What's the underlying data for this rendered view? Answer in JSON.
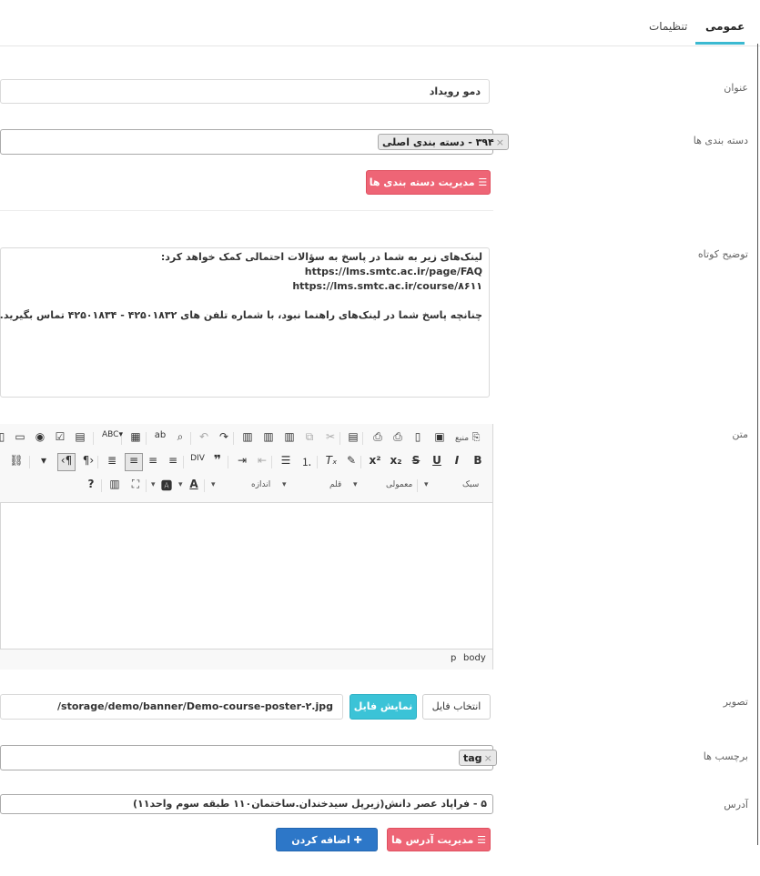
{
  "tabs": [
    {
      "label": "عمومی",
      "active": true
    },
    {
      "label": "تنظیمات",
      "active": false
    }
  ],
  "fields": {
    "title_label": "عنوان",
    "title_value": "دمو رویداد",
    "categories_label": "دسته بندی ها",
    "category_tag": "۳۹۴ - دسته بندی اصلی",
    "manage_categories_button": "مدیریت دسته بندی ها",
    "short_desc_label": "توضیح کوتاه",
    "short_desc_lines": [
      "لینک‌های زیر به شما در پاسخ به سؤالات احتمالی کمک خواهد کرد:",
      "https://lms.smtc.ac.ir/page/FAQ",
      "https://lms.smtc.ac.ir/course/۸۶۱۱",
      "",
      "چنانچه پاسخ شما در لینک‌های راهنما نبود، با شماره تلفن های ۴۲۵۰۱۸۳۲ - ۴۲۵۰۱۸۳۴ تماس بگیرید."
    ],
    "body_label": "متن",
    "image_label": "تصویر",
    "choose_file_button": "انتخاب فایل",
    "show_file_button": "نمایش فایل",
    "image_path": "/storage/demo/banner/Demo-course-poster-۲.jpg",
    "tags_label": "برچسب ها",
    "tag_value": "tag",
    "address_label": "آدرس",
    "address_value": "۵ - فراپاد عصر دانش(زیرپل سیدخندان.ساختمان۱۱۰ طبقه سوم واحد۱۱)",
    "manage_addresses_button": "مدیریت آدرس ها",
    "add_address_button": "اضافه کردن آدرس"
  },
  "editor": {
    "source_label": "منبع",
    "style_combo": "سبک",
    "format_combo": "معمولی",
    "font_combo": "قلم",
    "size_combo": "اندازه",
    "statusbar": [
      "body",
      "p"
    ]
  },
  "colors": {
    "accent": "#3bb9d1",
    "danger": "#ee6576",
    "info": "#3bc3d7",
    "primary": "#2d77c8"
  }
}
